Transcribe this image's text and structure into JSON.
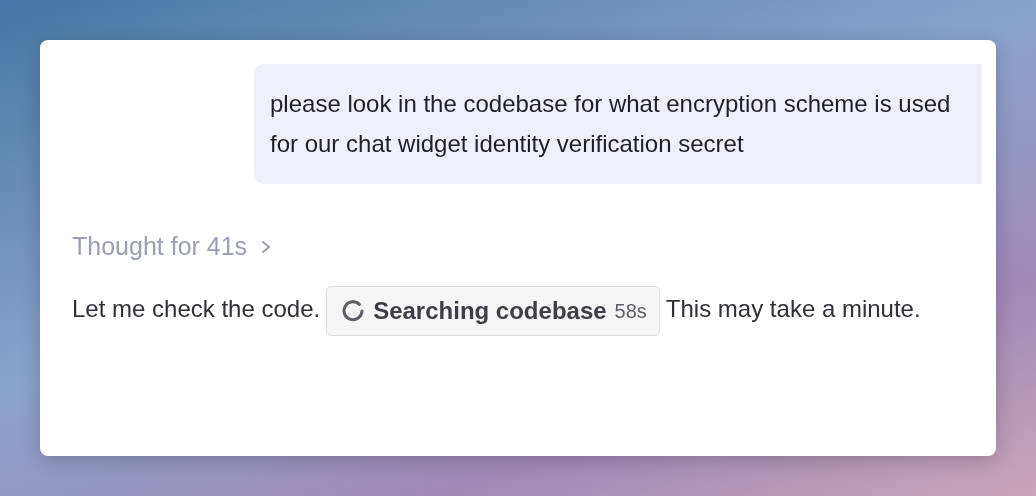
{
  "user_message": {
    "text": "please look in the codebase for what encryption scheme is used for our chat widget identity verification secret"
  },
  "thought": {
    "label": "Thought for 41s",
    "expanded": false
  },
  "response": {
    "before": "Let me check the code.",
    "tool_chip": {
      "label": "Searching codebase",
      "elapsed": "58s"
    },
    "after": "This may take a minute."
  }
}
